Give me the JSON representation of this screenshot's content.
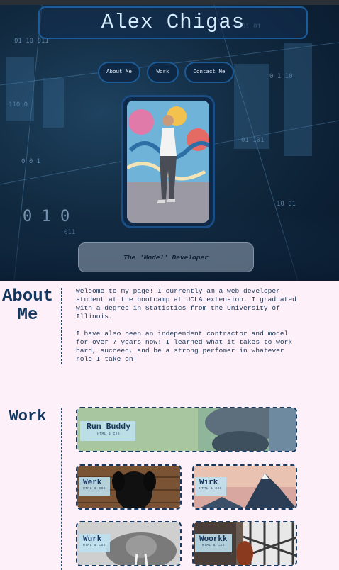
{
  "header": {
    "title": "Alex Chigas"
  },
  "nav": {
    "about": "About Me",
    "work": "Work",
    "contact": "Contact Me"
  },
  "hero": {
    "tagline": "The 'Model' Developer"
  },
  "about": {
    "heading": "About Me",
    "paragraphs": [
      "Welcome to my page! I currently am a web developer student at the bootcamp at UCLA extension. I graduated with a degree in Statistics from the University of Illinois.",
      "I have also been an independent contractor and model for over 7 years now! I learned what it takes to work hard, succeed, and be a strong perfomer in whatever role I take on!"
    ]
  },
  "work": {
    "heading": "Work",
    "projects": [
      {
        "title": "Run Buddy",
        "tech": "HTML & CSS"
      },
      {
        "title": "Werk",
        "tech": "HTML & CSS"
      },
      {
        "title": "Wirk",
        "tech": "HTML & CSS"
      },
      {
        "title": "Wurk",
        "tech": "HTML & CSS"
      },
      {
        "title": "Woorkk",
        "tech": "HTML & CSS"
      }
    ]
  },
  "colors": {
    "page_background": "#fdf0f8",
    "heading_navy": "#14375f",
    "hero_dark_blue": "#08172a",
    "accent_border_blue": "#1d5c9a",
    "title_text": "#d6ecff"
  },
  "images": {
    "hero_background": "digital-matrix-city-image",
    "profile_photo": "person-standing-by-mural-photo",
    "run_buddy": "runner-tying-shoe-image",
    "werk": "black-dog-on-wood-image",
    "wirk": "mountain-peak-sunset-image",
    "wurk": "walrus-black-white-image",
    "woorkk": "dog-by-window-image"
  }
}
